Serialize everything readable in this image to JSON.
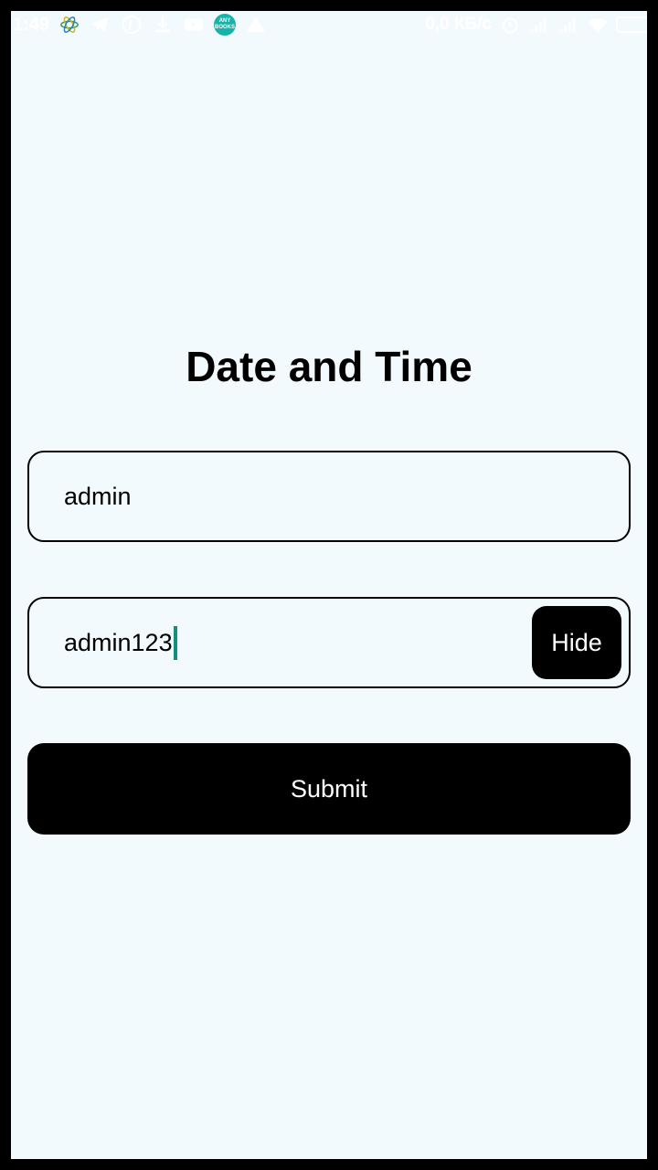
{
  "status_bar": {
    "time": "1:49",
    "network_speed": "0,0 КБ/с",
    "anybooks_top": "ANY",
    "anybooks_bottom": "BOOKS",
    "icons": [
      "atom-icon",
      "telegram-icon",
      "pinterest-icon",
      "download-icon",
      "youtube-icon",
      "anybooks-icon",
      "warning-icon",
      "alarm-icon",
      "signal-icon",
      "signal-icon",
      "wifi-icon",
      "battery-icon"
    ]
  },
  "page": {
    "title": "Date and Time"
  },
  "form": {
    "username_value": "admin",
    "password_value": "admin123",
    "hide_label": "Hide",
    "submit_label": "Submit"
  },
  "colors": {
    "background": "#f3fafd",
    "button": "#000000",
    "caret": "#148f7e",
    "anybooks": "#17b3a8"
  }
}
